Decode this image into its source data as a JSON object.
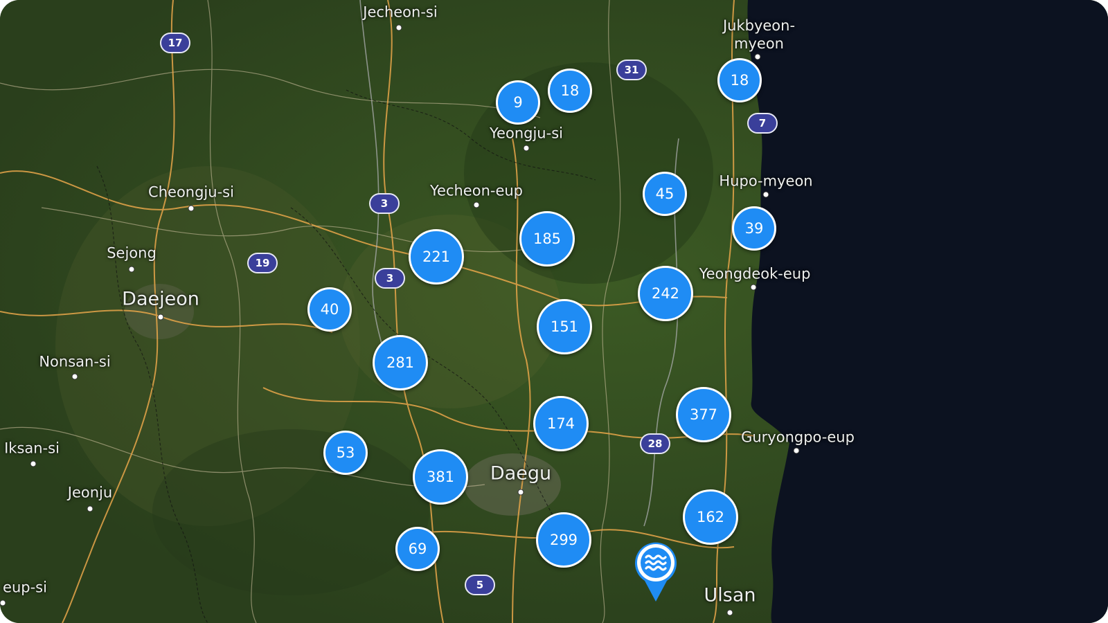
{
  "colors": {
    "cluster_fill": "#1f8cf4",
    "cluster_border": "#ffffff",
    "shield_fill": "#3a3f9a",
    "land": "#2f4520",
    "sea": "#0c1220"
  },
  "places": [
    {
      "name": "Jecheon-si",
      "size": "normal"
    },
    {
      "name": "Jukbyeon-\nmyeon",
      "size": "normal"
    },
    {
      "name": "Yeongju-si",
      "size": "normal"
    },
    {
      "name": "Cheongju-si",
      "size": "normal"
    },
    {
      "name": "Yecheon-eup",
      "size": "normal"
    },
    {
      "name": "Hupo-myeon",
      "size": "normal"
    },
    {
      "name": "Sejong",
      "size": "normal"
    },
    {
      "name": "Daejeon",
      "size": "big"
    },
    {
      "name": "Yeongdeok-eup",
      "size": "normal"
    },
    {
      "name": "Nonsan-si",
      "size": "normal"
    },
    {
      "name": "Iksan-si",
      "size": "normal"
    },
    {
      "name": "Guryongpo-eup",
      "size": "normal"
    },
    {
      "name": "Daegu",
      "size": "big"
    },
    {
      "name": "Jeonju",
      "size": "normal"
    },
    {
      "name": "eup-si",
      "size": "normal"
    },
    {
      "name": "Ulsan",
      "size": "big"
    }
  ],
  "road_shields": [
    "17",
    "31",
    "7",
    "3",
    "19",
    "3",
    "28",
    "5"
  ],
  "clusters": [
    {
      "count": "9"
    },
    {
      "count": "18"
    },
    {
      "count": "18"
    },
    {
      "count": "45"
    },
    {
      "count": "39"
    },
    {
      "count": "221"
    },
    {
      "count": "185"
    },
    {
      "count": "242"
    },
    {
      "count": "40"
    },
    {
      "count": "151"
    },
    {
      "count": "281"
    },
    {
      "count": "174"
    },
    {
      "count": "377"
    },
    {
      "count": "53"
    },
    {
      "count": "381"
    },
    {
      "count": "162"
    },
    {
      "count": "69"
    },
    {
      "count": "299"
    }
  ],
  "station_marker": {
    "icon": "water-waves-icon"
  }
}
